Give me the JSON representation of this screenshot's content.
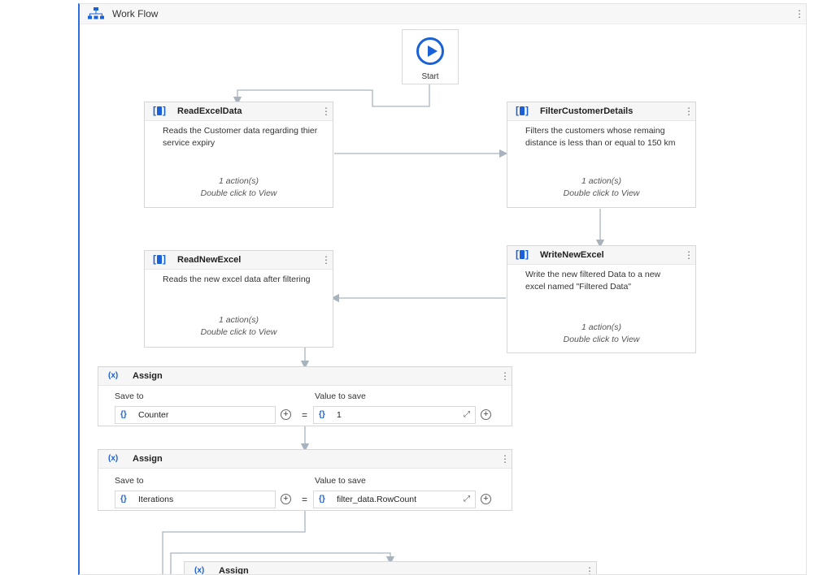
{
  "panel": {
    "title": "Work Flow"
  },
  "start": {
    "label": "Start"
  },
  "cards": [
    {
      "title": "ReadExcelData",
      "desc": "Reads the Customer data regarding thier service expiry",
      "actions": "1 action(s)",
      "hint": "Double click to View"
    },
    {
      "title": "FilterCustomerDetails",
      "desc": "Filters the customers whose remaing distance is less than or equal to 150 km",
      "actions": "1 action(s)",
      "hint": "Double click to View"
    },
    {
      "title": "ReadNewExcel",
      "desc": "Reads the new excel data after filtering",
      "actions": "1 action(s)",
      "hint": "Double click to View"
    },
    {
      "title": "WriteNewExcel",
      "desc": "Write the new filtered Data to a new excel named \"Filtered Data\"",
      "actions": "1 action(s)",
      "hint": "Double click to View"
    }
  ],
  "assigns": [
    {
      "title": "Assign",
      "save_to_label": "Save to",
      "value_label": "Value to save",
      "save_to": "Counter",
      "value": "1"
    },
    {
      "title": "Assign",
      "save_to_label": "Save to",
      "value_label": "Value to save",
      "save_to": "Iterations",
      "value": "filter_data.RowCount"
    },
    {
      "title": "Assign"
    }
  ],
  "icons": {
    "workflow": "workflow-icon",
    "sequence": "sequence-icon",
    "assign": "assign-variable-icon",
    "variable": "variable-braces-icon",
    "kebab": "kebab-menu-icon",
    "play": "play-icon"
  },
  "colors": {
    "accent": "#1a61d8",
    "connector": "#a9b3be"
  }
}
